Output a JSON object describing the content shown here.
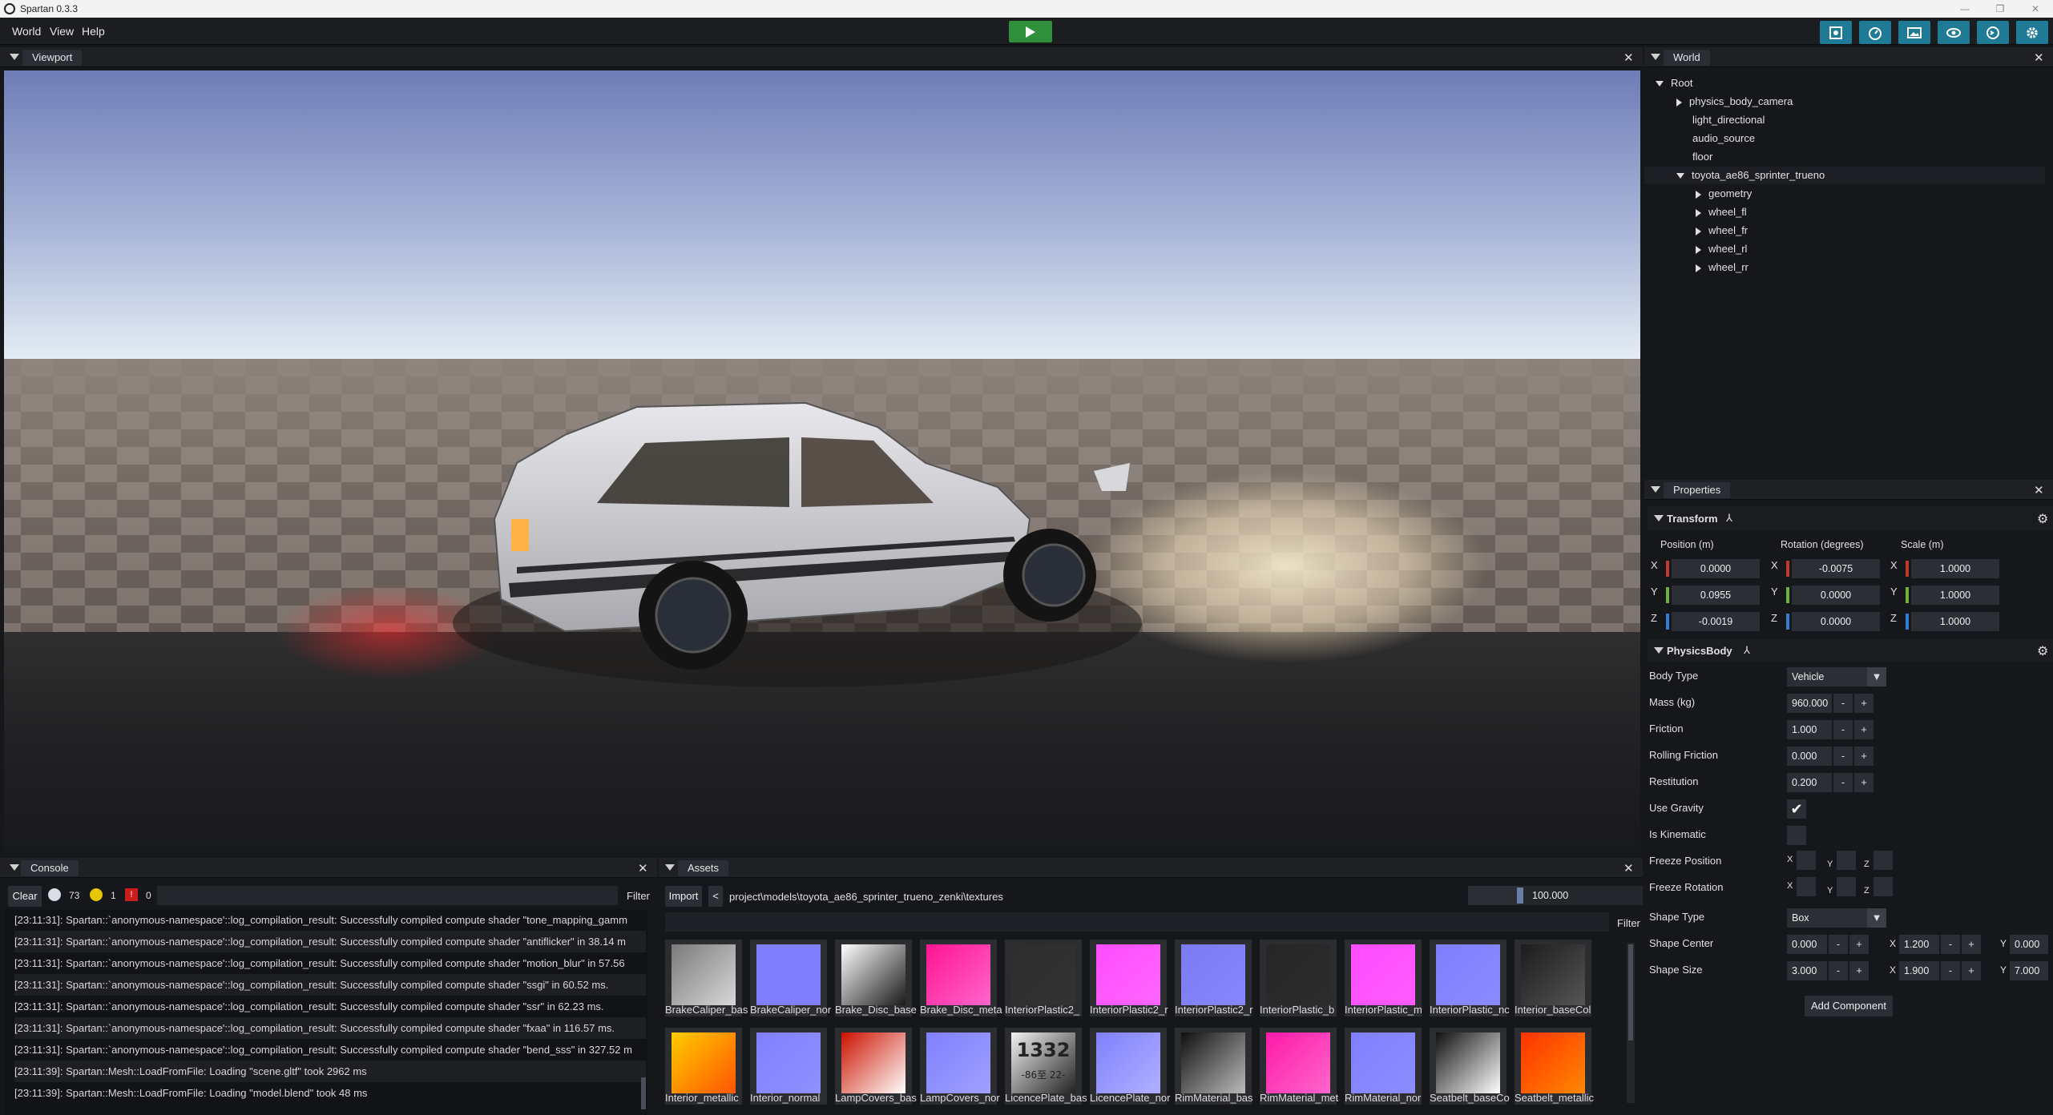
{
  "window": {
    "title": "Spartan 0.3.3",
    "controls": [
      "—",
      "❐",
      "✕"
    ]
  },
  "menu": {
    "items": [
      "World",
      "View",
      "Help"
    ]
  },
  "toolbar": {
    "icons": [
      "screenshot-icon",
      "profiler-icon",
      "image-icon",
      "visibility-icon",
      "script-icon",
      "settings-icon"
    ],
    "accent": "#1f7a96",
    "play_color": "#2f8f3a"
  },
  "viewport": {
    "tab": "Viewport"
  },
  "world": {
    "tab": "World",
    "root": "Root",
    "nodes": [
      {
        "label": "physics_body_camera",
        "arrow": "right"
      },
      {
        "label": "light_directional",
        "arrow": ""
      },
      {
        "label": "audio_source",
        "arrow": ""
      },
      {
        "label": "floor",
        "arrow": ""
      },
      {
        "label": "toyota_ae86_sprinter_trueno",
        "arrow": "down"
      }
    ],
    "children": [
      "geometry",
      "wheel_fl",
      "wheel_fr",
      "wheel_rl",
      "wheel_rr"
    ]
  },
  "properties": {
    "tab": "Properties",
    "transform": {
      "title": "Transform",
      "position_label": "Position (m)",
      "rotation_label": "Rotation (degrees)",
      "scale_label": "Scale (m)",
      "axes": [
        "X",
        "Y",
        "Z"
      ],
      "position": [
        "0.0000",
        "0.0955",
        "-0.0019"
      ],
      "rotation": [
        "-0.0075",
        "0.0000",
        "0.0000"
      ],
      "scale": [
        "1.0000",
        "1.0000",
        "1.0000"
      ],
      "axis_colors": [
        "#c0392b",
        "#6fb23a",
        "#2f7fd6"
      ]
    },
    "physics": {
      "title": "PhysicsBody",
      "body_type_label": "Body Type",
      "body_type": "Vehicle",
      "mass_label": "Mass (kg)",
      "mass": "960.000",
      "friction_label": "Friction",
      "friction": "1.000",
      "rolling_label": "Rolling Friction",
      "rolling": "0.000",
      "restitution_label": "Restitution",
      "restitution": "0.200",
      "gravity_label": "Use Gravity",
      "kinematic_label": "Is Kinematic",
      "freeze_pos_label": "Freeze Position",
      "freeze_rot_label": "Freeze Rotation",
      "shape_type_label": "Shape Type",
      "shape_type": "Box",
      "shape_center_label": "Shape Center",
      "shape_center": [
        "0.000",
        "1.200",
        "0.000"
      ],
      "shape_size_label": "Shape Size",
      "shape_size": [
        "3.000",
        "1.900",
        "7.000"
      ],
      "minus": "-",
      "plus": "+"
    },
    "add_component": "Add Component"
  },
  "console": {
    "tab": "Console",
    "clear": "Clear",
    "info_count": "73",
    "warn_count": "1",
    "error_count": "0",
    "filter": "Filter",
    "lines": [
      "[23:11:31]: Spartan::`anonymous-namespace'::log_compilation_result: Successfully compiled compute shader \"tone_mapping_gamm",
      "[23:11:31]: Spartan::`anonymous-namespace'::log_compilation_result: Successfully compiled compute shader \"antiflicker\" in 38.14 m",
      "[23:11:31]: Spartan::`anonymous-namespace'::log_compilation_result: Successfully compiled compute shader \"motion_blur\" in 57.56",
      "[23:11:31]: Spartan::`anonymous-namespace'::log_compilation_result: Successfully compiled compute shader \"ssgi\" in 60.52 ms.",
      "[23:11:31]: Spartan::`anonymous-namespace'::log_compilation_result: Successfully compiled compute shader \"ssr\" in 62.23 ms.",
      "[23:11:31]: Spartan::`anonymous-namespace'::log_compilation_result: Successfully compiled compute shader \"fxaa\" in 116.57 ms.",
      "[23:11:31]: Spartan::`anonymous-namespace'::log_compilation_result: Successfully compiled compute shader \"bend_sss\" in 327.52 m",
      "[23:11:39]: Spartan::Mesh::LoadFromFile: Loading \"scene.gltf\" took 2962 ms",
      "[23:11:39]: Spartan::Mesh::LoadFromFile: Loading \"model.blend\" took 48 ms"
    ]
  },
  "assets": {
    "tab": "Assets",
    "import": "Import",
    "back": "<",
    "path": "project\\models\\toyota_ae86_sprinter_trueno_zenki\\textures",
    "zoom": "100.000",
    "zoom_fraction": 0.3,
    "filter": "Filter",
    "row1": [
      {
        "name": "BrakeCaliper_bas",
        "c1": "#7a7a7a",
        "c2": "#d8d8d8"
      },
      {
        "name": "BrakeCaliper_nor",
        "c1": "#7f7fff",
        "c2": "#7f7fff"
      },
      {
        "name": "Brake_Disc_base",
        "c1": "#ffffff",
        "c2": "#1a1a1a"
      },
      {
        "name": "Brake_Disc_meta",
        "c1": "#ff1493",
        "c2": "#ff66cc"
      },
      {
        "name": "InteriorPlastic2_",
        "c1": "#2e2e2e",
        "c2": "#333333"
      },
      {
        "name": "InteriorPlastic2_r",
        "c1": "#ff4dff",
        "c2": "#ff66ff"
      },
      {
        "name": "InteriorPlastic2_r",
        "c1": "#7b7bf2",
        "c2": "#8686ff"
      },
      {
        "name": "InteriorPlastic_b",
        "c1": "#262626",
        "c2": "#2c2c2c"
      },
      {
        "name": "InteriorPlastic_m",
        "c1": "#ff4dff",
        "c2": "#ff5cff"
      },
      {
        "name": "InteriorPlastic_nc",
        "c1": "#7f7fff",
        "c2": "#8a8aff"
      },
      {
        "name": "Interior_baseCol",
        "c1": "#1c1c1c",
        "c2": "#555555"
      }
    ],
    "row2": [
      {
        "name": "Interior_metallic",
        "c1": "#ffcc00",
        "c2": "#ff5500"
      },
      {
        "name": "Interior_normal",
        "c1": "#8080ff",
        "c2": "#9090ff"
      },
      {
        "name": "LampCovers_bas",
        "c1": "#cc1100",
        "c2": "#ffffff"
      },
      {
        "name": "LampCovers_nor",
        "c1": "#8080ff",
        "c2": "#a0a0ff"
      },
      {
        "name": "LicencePlate_bas",
        "c1": "#f2f2f2",
        "c2": "#222222",
        "text": "1332",
        "sub": "-86至 22-"
      },
      {
        "name": "LicencePlate_nor",
        "c1": "#8080ff",
        "c2": "#b0b0ff"
      },
      {
        "name": "RimMaterial_bas",
        "c1": "#101010",
        "c2": "#bbbbbb"
      },
      {
        "name": "RimMaterial_met",
        "c1": "#ff1aa8",
        "c2": "#ff66cc"
      },
      {
        "name": "RimMaterial_nor",
        "c1": "#8080ff",
        "c2": "#8c8cff"
      },
      {
        "name": "Seatbelt_baseCo",
        "c1": "#111111",
        "c2": "#ffffff"
      },
      {
        "name": "Seatbelt_metallic",
        "c1": "#ff3300",
        "c2": "#ff8800"
      }
    ]
  }
}
